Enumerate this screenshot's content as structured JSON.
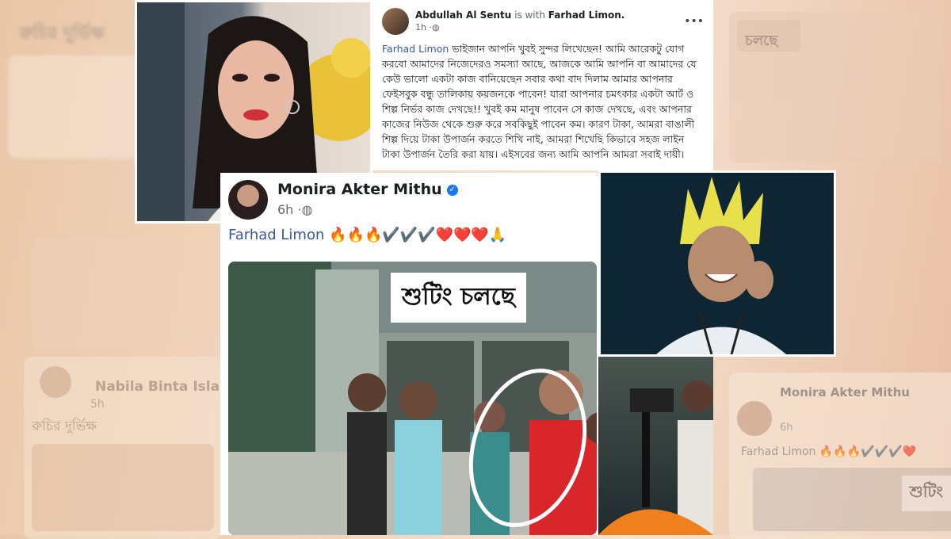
{
  "background": {
    "left_post": {
      "author": "Nabila Binta Islam",
      "time": "5h",
      "headline": "রুচির দুর্ভিক্ষ"
    },
    "top_left_headline": "রুচির দুর্ভিক্ষ",
    "right_post": {
      "author": "Monira Akter Mithu",
      "time": "6h",
      "text": "Farhad Limon 🔥🔥🔥✔️✔️✔️❤️",
      "caption": "শুটিং"
    },
    "top_right_caption": "চলছে"
  },
  "top_post": {
    "author": "Abdullah Al Sentu",
    "with_text": "is with",
    "tagged": "Farhad Limon.",
    "time": "1h",
    "more_label": "•••",
    "mention": "Farhad Limon",
    "body": "ভাইজান আপনি খুবই সুন্দর লিখেছেন! আমি আরেকটু যোগ করবো আমাদের নিজেদেরও সমস্যা আছে, আজকে আমি আপনি বা আমাদের যে কেউ ভালো একটা কাজ বানিয়েছেন সবার কথা বাদ দিলাম আমার আপনার ফেইসবুক বন্ধু তালিকায় কয়জনকে পাবেন! যারা আপনার চমৎকার একটা আর্ট ও শিল্প নির্ভর কাজ দেখছে!! খুবই কম মানুষ পাবেন সে কাজ দেখছে, এবং আপনার কাজের নিউজ থেকে শুরু করে সবকিছুই পাবেন কম। কারণ টাকা, আমরা বাঙালী শিল্প দিয়ে টাকা উপার্জন করতে শিখি নাই, আমরা শিখেছি কিভাবে সহজ লাইন টাকা উপার্জন তৈরি করা যায়। এইসবের জন্য আমি আপনি আমরা সবাই দায়ী।"
  },
  "main_post": {
    "author": "Monira Akter Mithu",
    "time": "6h",
    "mention": "Farhad Limon",
    "emojis": "🔥🔥🔥✔️✔️✔️❤️❤️❤️🙏",
    "video_caption": "শুটিং চলছে"
  },
  "colors": {
    "link": "#385898",
    "verified": "#1877f2",
    "highlight_circle": "#ffffff"
  }
}
